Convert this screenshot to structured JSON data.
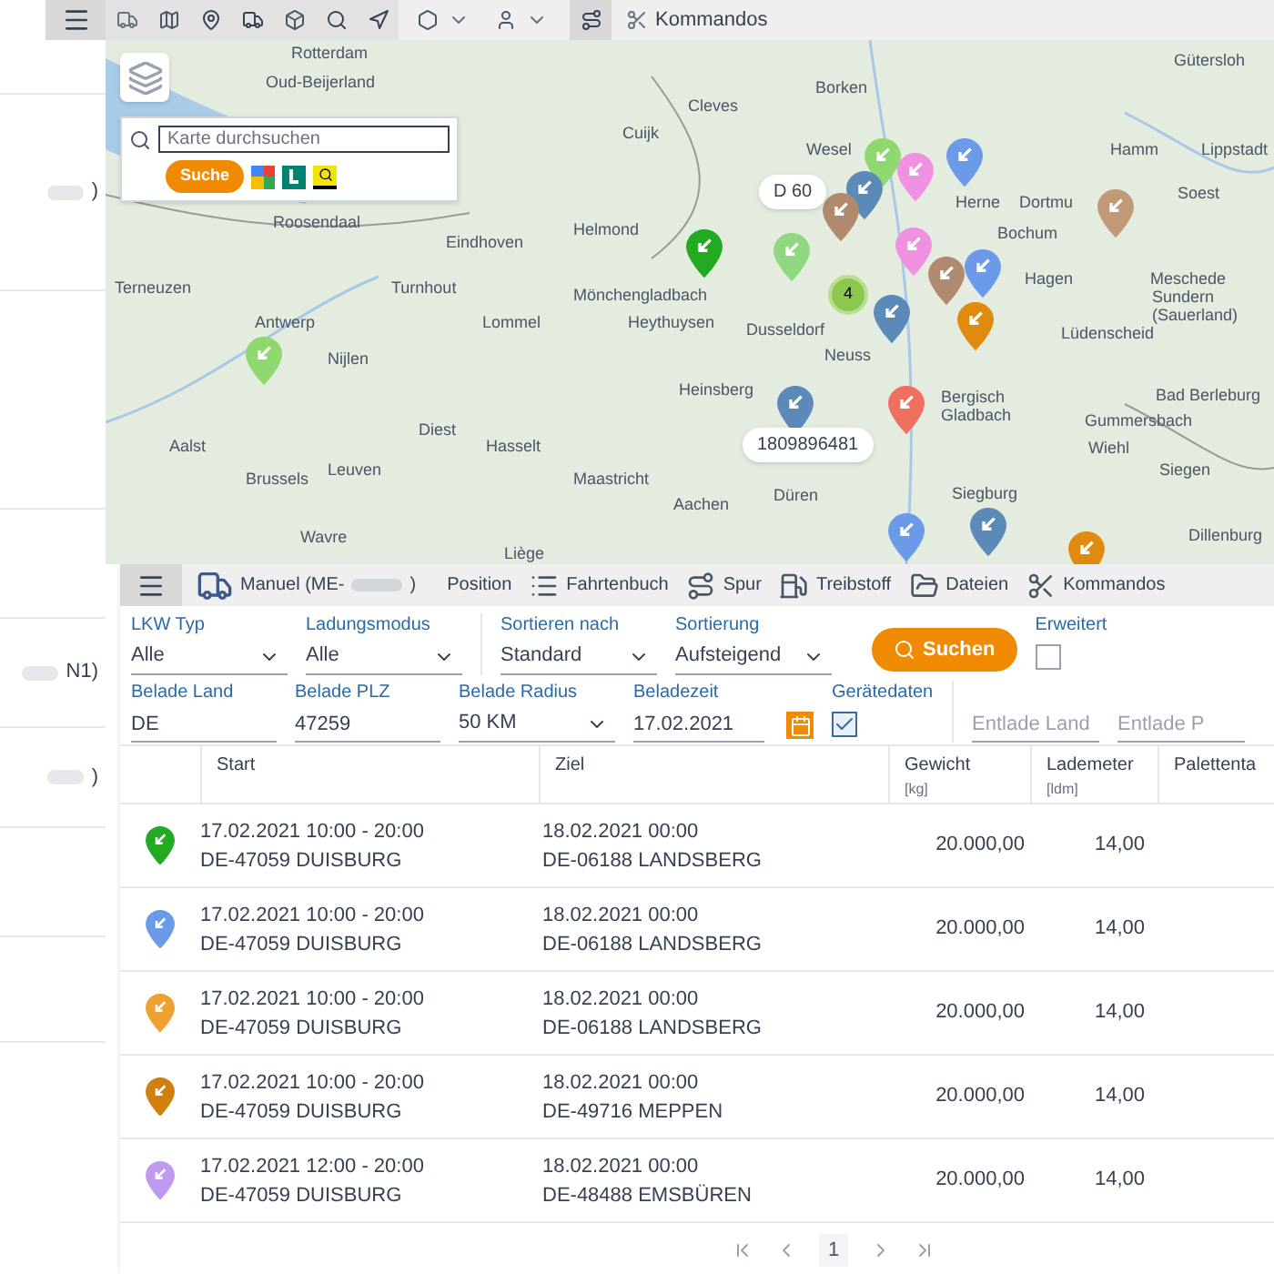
{
  "sidebar": {
    "items": [
      {
        "text": ")"
      },
      {
        "text": "N1)"
      },
      {
        "text": ")"
      }
    ]
  },
  "toolbar": {
    "commands_label": "Kommandos"
  },
  "map": {
    "search": {
      "placeholder": "Karte durchsuchen",
      "button": "Suche"
    },
    "places": [
      "Rotterdam",
      "Gütersloh",
      "Oud-Beijerland",
      "Borken",
      "Cleves",
      "Cuijk",
      "Wesel",
      "Hamm",
      "Lippstadt",
      "Soest",
      "Herne",
      "Dortmu",
      "Roosendaal",
      "Helmond",
      "Bochum",
      "Eindhoven",
      "Hagen",
      "Meschede",
      "Terneuzen",
      "Turnhout",
      "Mönchengladbach",
      "Sundern (Sauerland)",
      "Antwerp",
      "Lommel",
      "Heythuysen",
      "Dusseldorf",
      "Lüdenscheid",
      "Neuss",
      "Nijlen",
      "Heinsberg",
      "Bergisch Gladbach",
      "Bad Berleburg",
      "Gummersbach",
      "Diest",
      "Aalst",
      "Hasselt",
      "Wiehl",
      "Leuven",
      "Siegen",
      "Brussels",
      "Maastricht",
      "Düren",
      "Siegburg",
      "Aachen",
      "Dillenburg",
      "Wavre",
      "Liège"
    ],
    "pins": [
      {
        "color": "#8fd870"
      },
      {
        "color": "#6a9ae8"
      },
      {
        "color": "#f090e0"
      },
      {
        "color": "#5b8ab8"
      },
      {
        "color": "#b08a6e"
      },
      {
        "color": "#c09a78"
      },
      {
        "color": "#22aa22"
      },
      {
        "color": "#90d880"
      },
      {
        "color": "#f090e0"
      },
      {
        "color": "#6a9ae8"
      },
      {
        "color": "#b08a6e"
      },
      {
        "color": "#5b8ab8"
      },
      {
        "color": "#e08a10"
      },
      {
        "color": "#8fd870"
      },
      {
        "color": "#5b8ab8"
      },
      {
        "color": "#f07060"
      },
      {
        "color": "#5b8ab8"
      },
      {
        "color": "#6a9ae8"
      },
      {
        "color": "#e08a10"
      }
    ],
    "cluster": "4",
    "vehicle_labels": [
      "D 60",
      "1809896481"
    ]
  },
  "panel": {
    "tabs": [
      {
        "kind": "vehicle",
        "label": "Manuel (ME-",
        "suffix": ")"
      },
      {
        "kind": "plain",
        "label": "Position"
      },
      {
        "kind": "logbook",
        "label": "Fahrtenbuch"
      },
      {
        "kind": "track",
        "label": "Spur"
      },
      {
        "kind": "fuel",
        "label": "Treibstoff"
      },
      {
        "kind": "files",
        "label": "Dateien"
      },
      {
        "kind": "commands",
        "label": "Kommandos"
      }
    ],
    "filter_rows": [
      [
        {
          "kind": "select",
          "label": "LKW Typ",
          "value": "Alle"
        },
        {
          "kind": "select",
          "label": "Ladungsmodus",
          "value": "Alle"
        },
        {
          "kind": "divider"
        },
        {
          "kind": "select",
          "label": "Sortieren nach",
          "value": "Standard"
        },
        {
          "kind": "select",
          "label": "Sortierung",
          "value": "Aufsteigend"
        },
        {
          "kind": "button",
          "label": "Suchen"
        },
        {
          "kind": "checkbox",
          "label": "Erweitert",
          "checked": false
        }
      ],
      [
        {
          "kind": "input",
          "label": "Belade Land",
          "value": "DE"
        },
        {
          "kind": "input",
          "label": "Belade PLZ",
          "value": "47259"
        },
        {
          "kind": "select",
          "label": "Belade Radius",
          "value": "50 KM"
        },
        {
          "kind": "date",
          "label": "Beladezeit",
          "value": "17.02.2021"
        },
        {
          "kind": "checkbox",
          "label": "Gerätedaten",
          "checked": true
        },
        {
          "kind": "divider"
        },
        {
          "kind": "input",
          "placeholder": "Entlade Land"
        },
        {
          "kind": "input",
          "placeholder": "Entlade P"
        }
      ]
    ],
    "table": {
      "columns": [
        {
          "label": "Start"
        },
        {
          "label": "Ziel"
        },
        {
          "label": "Gewicht",
          "unit": "[kg]"
        },
        {
          "label": "Lademeter",
          "unit": "[ldm]"
        },
        {
          "label": "Palettenta"
        }
      ],
      "rows": [
        {
          "color": "#22aa22",
          "start_time": "17.02.2021 10:00 - 20:00",
          "start_place": "DE-47059 DUISBURG",
          "end_time": "18.02.2021 00:00",
          "end_place": "DE-06188 LANDSBERG",
          "weight": "20.000,00",
          "meters": "14,00"
        },
        {
          "color": "#6a9ae8",
          "start_time": "17.02.2021 10:00 - 20:00",
          "start_place": "DE-47059 DUISBURG",
          "end_time": "18.02.2021 00:00",
          "end_place": "DE-06188 LANDSBERG",
          "weight": "20.000,00",
          "meters": "14,00"
        },
        {
          "color": "#f0a030",
          "start_time": "17.02.2021 10:00 - 20:00",
          "start_place": "DE-47059 DUISBURG",
          "end_time": "18.02.2021 00:00",
          "end_place": "DE-06188 LANDSBERG",
          "weight": "20.000,00",
          "meters": "14,00"
        },
        {
          "color": "#d08010",
          "start_time": "17.02.2021 10:00 - 20:00",
          "start_place": "DE-47059 DUISBURG",
          "end_time": "18.02.2021 00:00",
          "end_place": "DE-49716 MEPPEN",
          "weight": "20.000,00",
          "meters": "14,00"
        },
        {
          "color": "#c09af0",
          "start_time": "17.02.2021 12:00 - 20:00",
          "start_place": "DE-47059 DUISBURG",
          "end_time": "18.02.2021 00:00",
          "end_place": "DE-48488 EMSBÜREN",
          "weight": "20.000,00",
          "meters": "14,00"
        }
      ]
    },
    "pagination": {
      "page": "1"
    }
  }
}
